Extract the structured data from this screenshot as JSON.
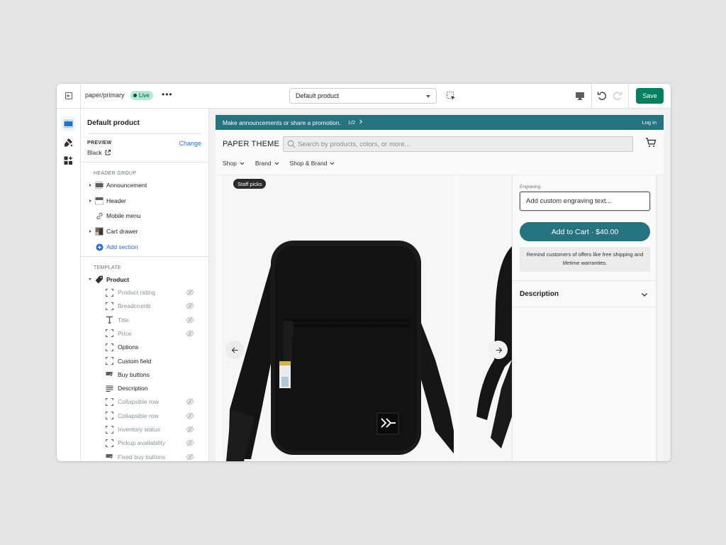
{
  "topbar": {
    "theme_name": "paper/primary",
    "status_badge": "Live",
    "more_label": "•••",
    "template_select": {
      "selected": "Default product"
    },
    "save_label": "Save",
    "colors": {
      "save": "#008060",
      "live_badge_bg": "#aee9d1"
    }
  },
  "rail": {
    "items": [
      {
        "icon": "sections-icon",
        "active": true
      },
      {
        "icon": "theme-settings-brush-icon",
        "active": false
      },
      {
        "icon": "app-embeds-icon",
        "active": false
      }
    ]
  },
  "sidebar": {
    "title": "Default product",
    "preview": {
      "label": "PREVIEW",
      "value": "Black",
      "change_label": "Change"
    },
    "header_group": {
      "label": "HEADER GROUP",
      "items": [
        {
          "label": "Announcement",
          "icon": "section-icon",
          "expandable": true
        },
        {
          "label": "Header",
          "icon": "header-icon",
          "expandable": true
        },
        {
          "label": "Mobile menu",
          "icon": "link-icon",
          "expandable": false
        },
        {
          "label": "Cart drawer",
          "icon": "image-thumbnail-icon",
          "expandable": true
        }
      ],
      "add_section_label": "Add section"
    },
    "template": {
      "label": "TEMPLATE",
      "product_label": "Product",
      "blocks": [
        {
          "label": "Product rating",
          "icon": "block-icon",
          "hidden": true
        },
        {
          "label": "Breadcrumb",
          "icon": "block-icon",
          "hidden": true
        },
        {
          "label": "Title",
          "icon": "text-icon",
          "hidden": true
        },
        {
          "label": "Price",
          "icon": "block-icon",
          "hidden": true
        },
        {
          "label": "Options",
          "icon": "block-icon",
          "hidden": false
        },
        {
          "label": "Custom field",
          "icon": "block-icon",
          "hidden": false
        },
        {
          "label": "Buy buttons",
          "icon": "buy-button-icon",
          "hidden": false
        },
        {
          "label": "Description",
          "icon": "text-align-icon",
          "hidden": false
        },
        {
          "label": "Collapsible row",
          "icon": "block-icon",
          "hidden": true
        },
        {
          "label": "Collapsible row",
          "icon": "block-icon",
          "hidden": true
        },
        {
          "label": "Inventory status",
          "icon": "block-icon",
          "hidden": true
        },
        {
          "label": "Pickup availability",
          "icon": "block-icon",
          "hidden": true
        },
        {
          "label": "Fixed buy buttons",
          "icon": "buy-button-icon",
          "hidden": true
        }
      ]
    }
  },
  "store": {
    "announcement": {
      "text": "Make announcements or share a promotion.",
      "pager": "1/2",
      "login": "Log in",
      "color": "#24737f"
    },
    "brand": "PAPER THEME",
    "search": {
      "placeholder": "Search by products, colors, or more..."
    },
    "nav": [
      {
        "label": "Shop"
      },
      {
        "label": "Brand"
      },
      {
        "label": "Shop & Brand"
      }
    ],
    "gallery": {
      "badge": "Staff picks",
      "image_alt": "Black crossbody bag"
    },
    "product": {
      "engraving_label": "Engraving",
      "engraving_placeholder": "Add custom engraving text...",
      "add_to_cart": "Add to Cart · $40.00",
      "reminder": "Remind customers of offers like free shipping and lifetime warranties.",
      "description_label": "Description"
    }
  }
}
